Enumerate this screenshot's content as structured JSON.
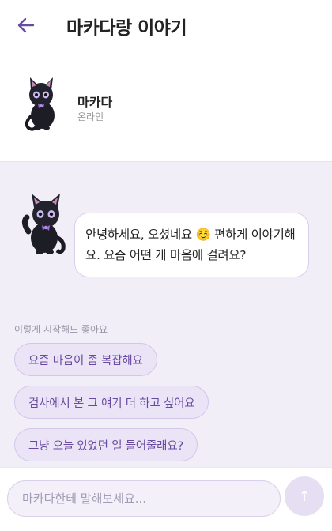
{
  "header": {
    "title": "마카다랑 이야기"
  },
  "profile": {
    "name": "마카다",
    "status": "온라인"
  },
  "chat": {
    "messages": [
      {
        "text": "안녕하세요, 오셨네요 ☺️ 편하게 이야기해요. 요즘 어떤 게 마음에 걸려요?"
      }
    ],
    "suggestion_label": "이렇게 시작해도 좋아요",
    "suggestions": [
      "요즘 마음이 좀 복잡해요",
      "검사에서 본 그 얘기 더 하고 싶어요",
      "그냥 오늘 있었던 일 들어줄래요?"
    ]
  },
  "composer": {
    "placeholder": "마카다한테 말해보세요...",
    "send_icon": "↑"
  },
  "colors": {
    "accent": "#6a4aa0",
    "chat_bg": "#f1eef8",
    "chip_bg": "#eae4f6"
  }
}
